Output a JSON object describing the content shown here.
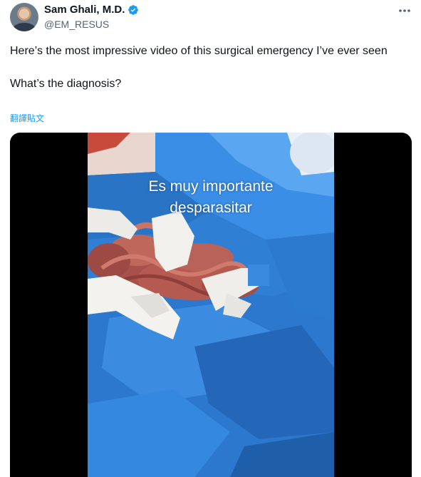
{
  "author": {
    "display_name": "Sam Ghali, M.D.",
    "handle": "@EM_RESUS",
    "verified_color": "#1d9bf0"
  },
  "tweet": {
    "line1": "Here’s the most impressive video of this surgical emergency I’ve ever seen",
    "line2": "What’s the diagnosis?",
    "translate_label": "翻譯貼文"
  },
  "video": {
    "caption_line1": "Es muy importante",
    "caption_line2": "desparasitar"
  },
  "icons": {
    "more": "more-horizontal-icon",
    "verified": "verified-badge-icon"
  }
}
